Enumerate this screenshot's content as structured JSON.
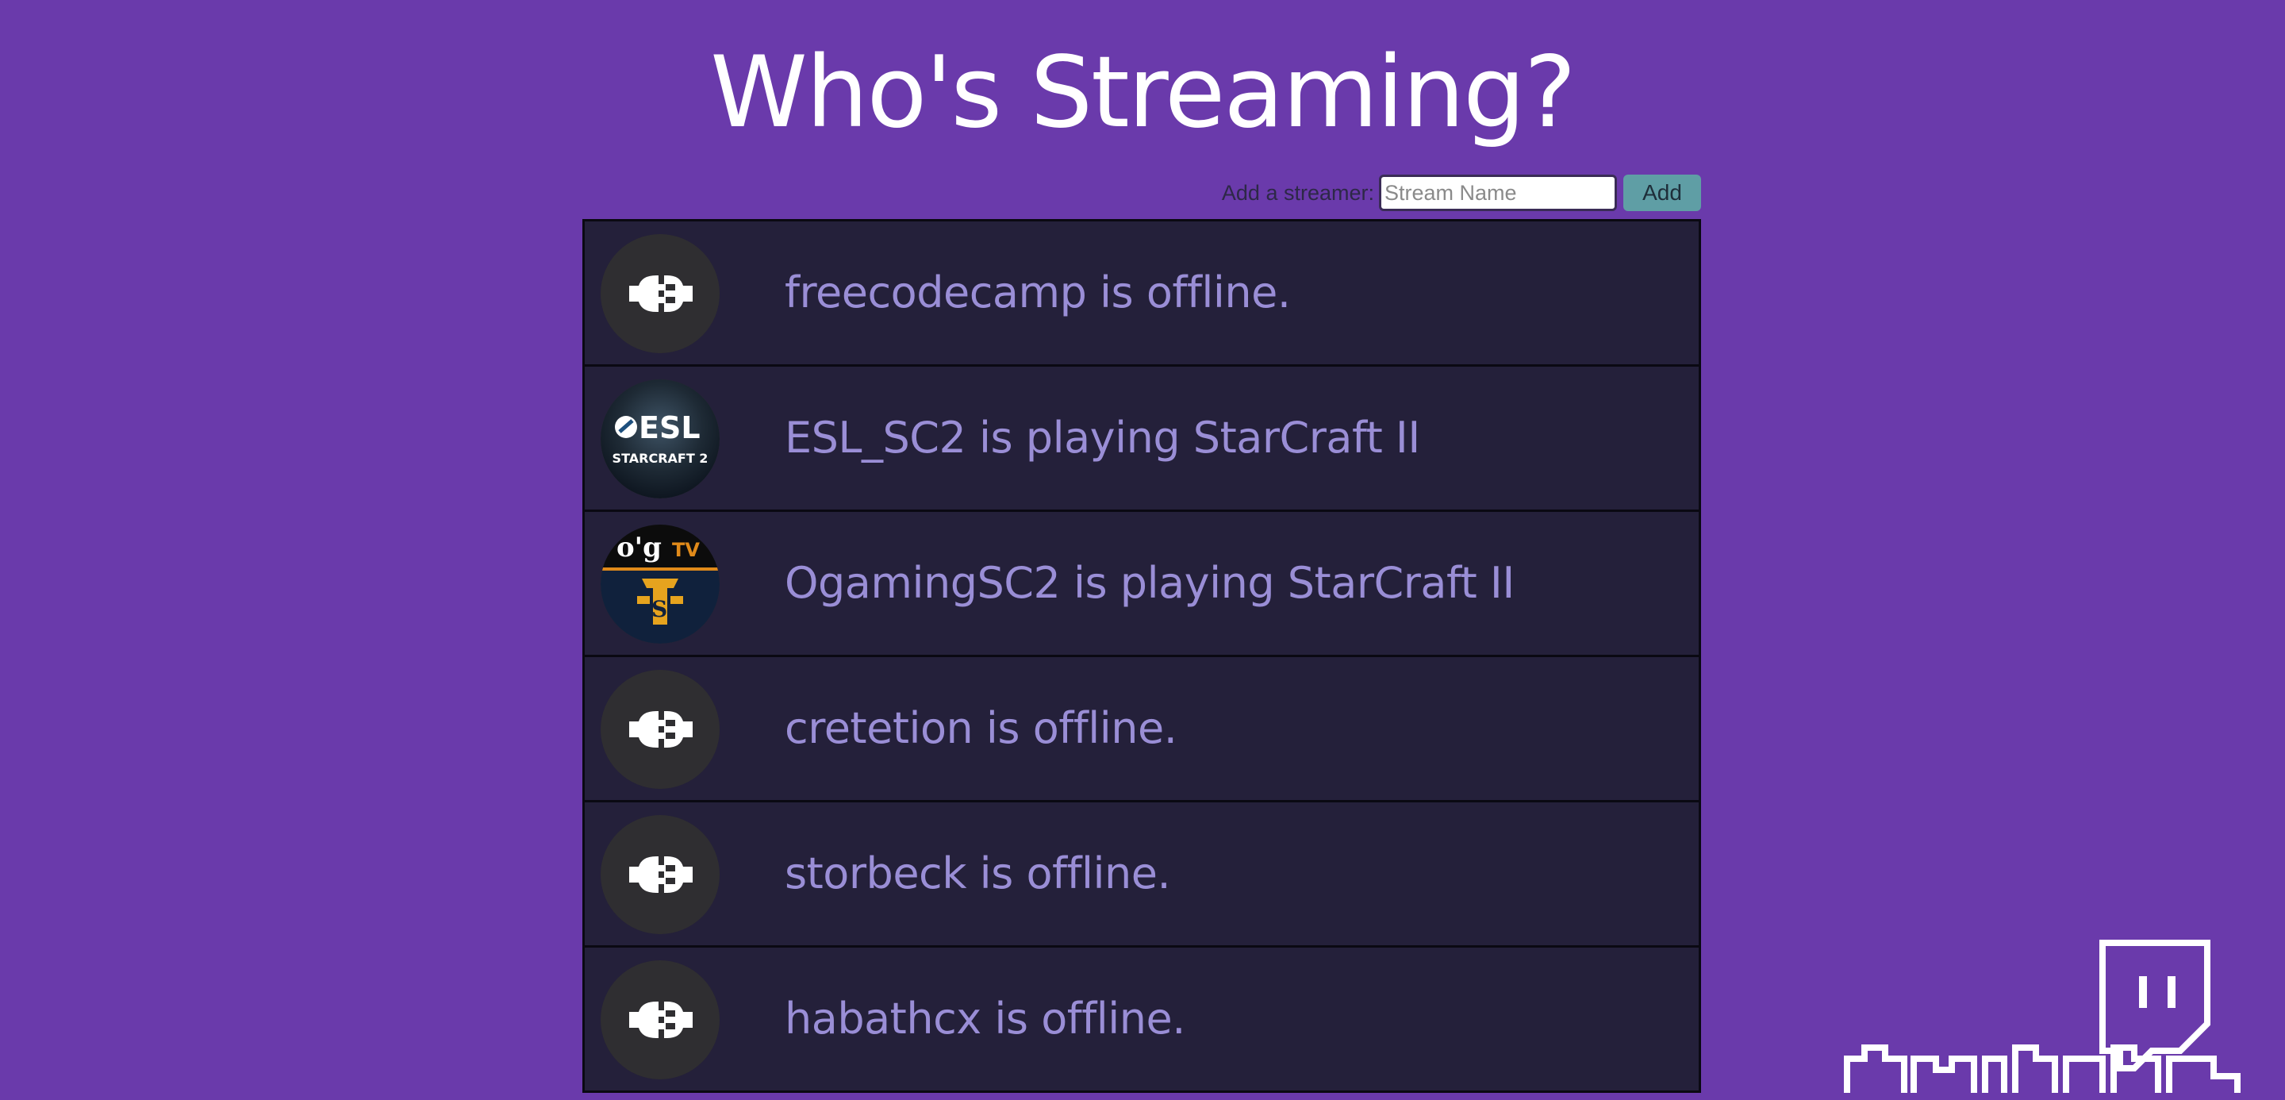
{
  "page": {
    "title": "Who's Streaming?"
  },
  "add_form": {
    "label": "Add a streamer:",
    "input_placeholder": "Stream Name",
    "input_value": "",
    "button_label": "Add"
  },
  "streams": [
    {
      "text": "freecodecamp is offline.",
      "avatar": "plug-icon"
    },
    {
      "text": "ESL_SC2 is playing StarCraft II",
      "avatar": "esl-logo",
      "logo_text": "ESL",
      "logo_subtext": "STARCRAFT 2"
    },
    {
      "text": "OgamingSC2 is playing StarCraft II",
      "avatar": "ogtv-logo",
      "logo_text": "o'g",
      "logo_subtext": "TV"
    },
    {
      "text": "cretetion is offline.",
      "avatar": "plug-icon"
    },
    {
      "text": "storbeck is offline.",
      "avatar": "plug-icon"
    },
    {
      "text": "habathcx is offline.",
      "avatar": "plug-icon"
    }
  ],
  "colors": {
    "background": "#6a3aab",
    "row_background": "#24203a",
    "status_text": "#9a8ed6",
    "button": "#5f9ea5"
  }
}
